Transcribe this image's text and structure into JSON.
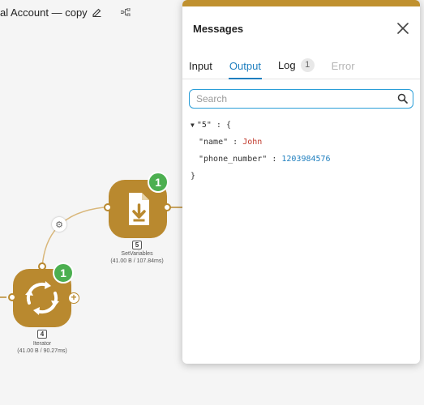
{
  "title_bar": {
    "title": "al Account — copy"
  },
  "scenario": {
    "nodes": [
      {
        "id": "setvariables",
        "number": "5",
        "label": "SetVariables",
        "stats": "(41.00 B / 107.84ms)",
        "badge": "1"
      },
      {
        "id": "iterator",
        "number": "4",
        "label": "Iterator",
        "stats": "(41.00 B / 90.27ms)",
        "badge": "1"
      }
    ]
  },
  "messages_panel": {
    "title": "Messages",
    "tabs": [
      {
        "label": "Input"
      },
      {
        "label": "Output"
      },
      {
        "label": "Log",
        "count": "1"
      },
      {
        "label": "Error"
      }
    ],
    "active_tab": "Output",
    "search": {
      "placeholder": "Search",
      "value": ""
    },
    "output": {
      "root_key": "\"5\"",
      "open_brace": "{",
      "close_brace": "}",
      "fields": [
        {
          "key": "\"name\"",
          "value": "John",
          "type": "string"
        },
        {
          "key": "\"phone_number\"",
          "value": "1203984576",
          "type": "number"
        }
      ]
    }
  },
  "colors": {
    "module_color": "#b9892f",
    "panel_accent": "#c0912f",
    "badge_green": "#4caf50",
    "active_tab": "#1f7fbf",
    "search_border": "#2a9ed8",
    "string_value": "#c0392b",
    "number_value": "#1f7fbf"
  },
  "icons": {
    "edit": "pencil-icon",
    "tree": "tree-icon",
    "setvariables": "file-download-icon",
    "iterator": "refresh-cycle-icon",
    "gear": "gear-icon",
    "close": "close-icon",
    "search": "search-icon"
  }
}
